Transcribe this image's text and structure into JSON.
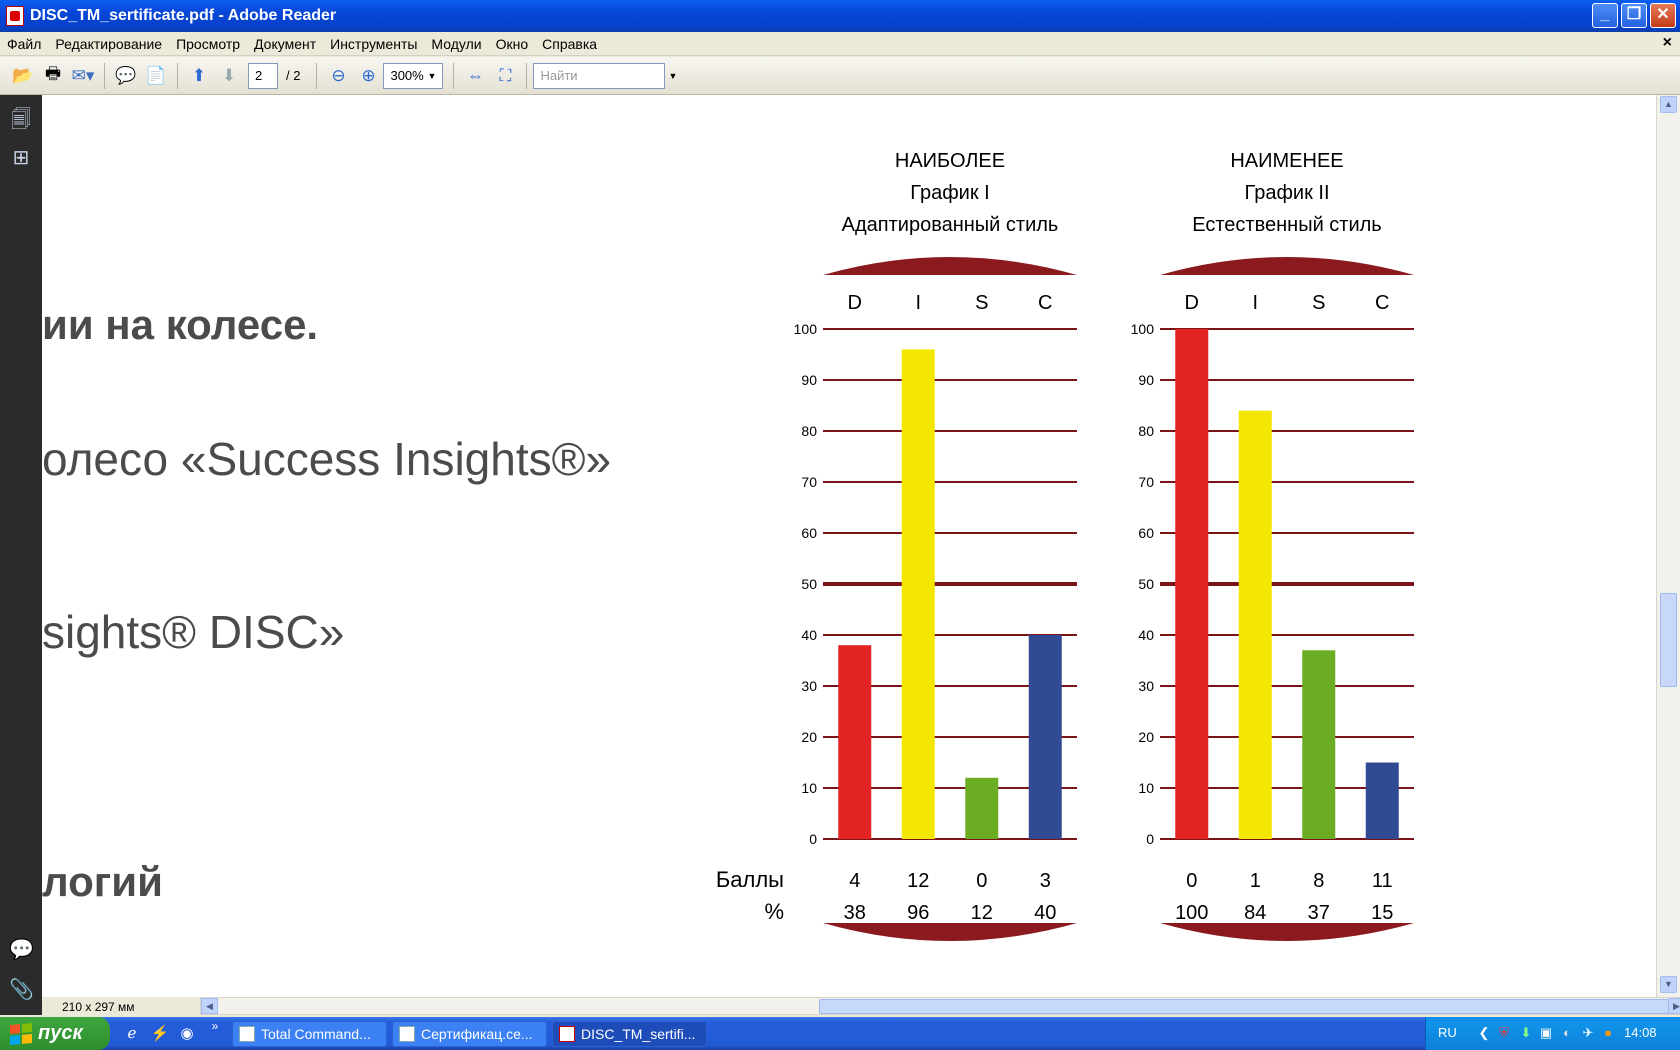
{
  "window": {
    "title": "DISC_TM_sertificate.pdf - Adobe Reader"
  },
  "menu": [
    "Файл",
    "Редактирование",
    "Просмотр",
    "Документ",
    "Инструменты",
    "Модули",
    "Окно",
    "Справка"
  ],
  "toolbar": {
    "page_current": "2",
    "page_total": "/ 2",
    "zoom": "300%",
    "find_placeholder": "Найти"
  },
  "doc_text": {
    "line1": "ии на колесе.",
    "line2": "олесо «Success Insights®»",
    "line3": "sights® DISC»",
    "line4": "логий"
  },
  "chart_labels": {
    "scores_label": "Баллы",
    "percent_label": "%"
  },
  "chart_data": [
    {
      "type": "bar",
      "title": "НАИБОЛЕЕ",
      "subtitle": "График I",
      "subtitle2": "Адаптированный стиль",
      "categories": [
        "D",
        "I",
        "S",
        "C"
      ],
      "values": [
        38,
        96,
        12,
        40
      ],
      "scores": [
        4,
        12,
        0,
        3
      ],
      "colors": [
        "#e32424",
        "#f3e600",
        "#6aad23",
        "#304a94"
      ],
      "ylim": [
        0,
        100
      ],
      "yticks": [
        0,
        10,
        20,
        30,
        40,
        50,
        60,
        70,
        80,
        90,
        100
      ],
      "grid": true
    },
    {
      "type": "bar",
      "title": "НАИМЕНЕЕ",
      "subtitle": "График II",
      "subtitle2": "Естественный стиль",
      "categories": [
        "D",
        "I",
        "S",
        "C"
      ],
      "values": [
        100,
        84,
        37,
        15
      ],
      "scores": [
        0,
        1,
        8,
        11
      ],
      "colors": [
        "#e32424",
        "#f3e600",
        "#6aad23",
        "#304a94"
      ],
      "ylim": [
        0,
        100
      ],
      "yticks": [
        0,
        10,
        20,
        30,
        40,
        50,
        60,
        70,
        80,
        90,
        100
      ],
      "grid": true
    }
  ],
  "status": {
    "page_size": "210 x 297 мм"
  },
  "taskbar": {
    "start": "пуск",
    "tasks": [
      "Total Command...",
      "Сертификац.се...",
      "DISC_TM_sertifi..."
    ],
    "lang": "RU",
    "clock": "14:08"
  }
}
